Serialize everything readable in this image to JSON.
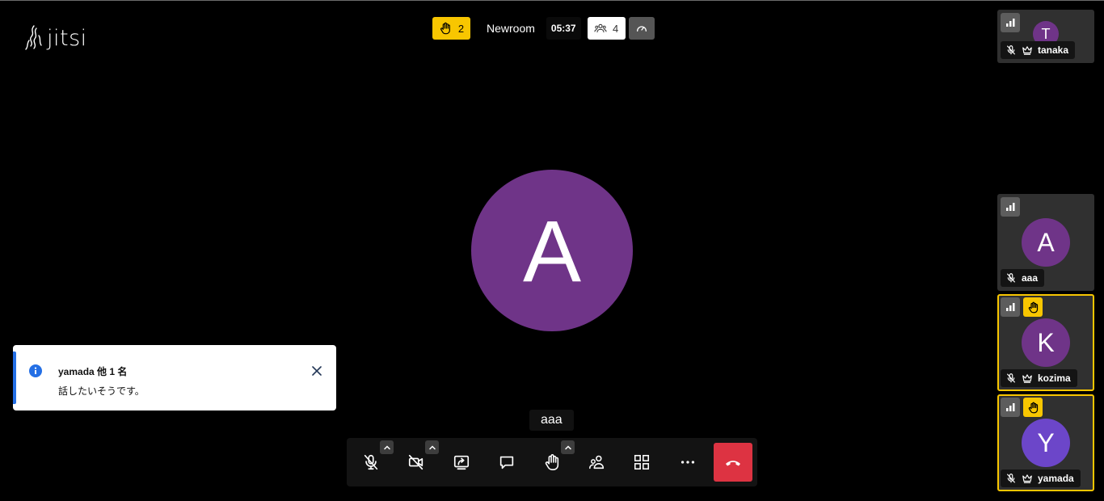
{
  "app": {
    "logo_text": "jitsi"
  },
  "topbar": {
    "raised_hands_count": "2",
    "room_name": "Newroom",
    "timer": "05:37",
    "participant_count": "4"
  },
  "stage": {
    "dominant_initial": "A",
    "dominant_name": "aaa",
    "avatar_color": "#6f3488"
  },
  "notification": {
    "title": "yamada 他 1 名",
    "description": "話したいそうです。",
    "accent_color": "#246fe5"
  },
  "toolbar": {
    "buttons": [
      "microphone-muted",
      "camera-off",
      "share-screen",
      "chat",
      "raise-hand",
      "participants",
      "tile-view",
      "more-actions",
      "hang-up"
    ],
    "hangup_color": "#dd3342"
  },
  "filmstrip": {
    "tiles": [
      {
        "initial": "T",
        "name": "tanaka",
        "raised": false,
        "moderator": true,
        "color": "#6f3488"
      },
      {
        "initial": "A",
        "name": "aaa",
        "raised": false,
        "moderator": false,
        "color": "#6f3488"
      },
      {
        "initial": "K",
        "name": "kozima",
        "raised": true,
        "moderator": true,
        "color": "#6f3488"
      },
      {
        "initial": "Y",
        "name": "yamada",
        "raised": true,
        "moderator": true,
        "color": "#6c46c9"
      }
    ],
    "raised_color": "#f8c600"
  }
}
